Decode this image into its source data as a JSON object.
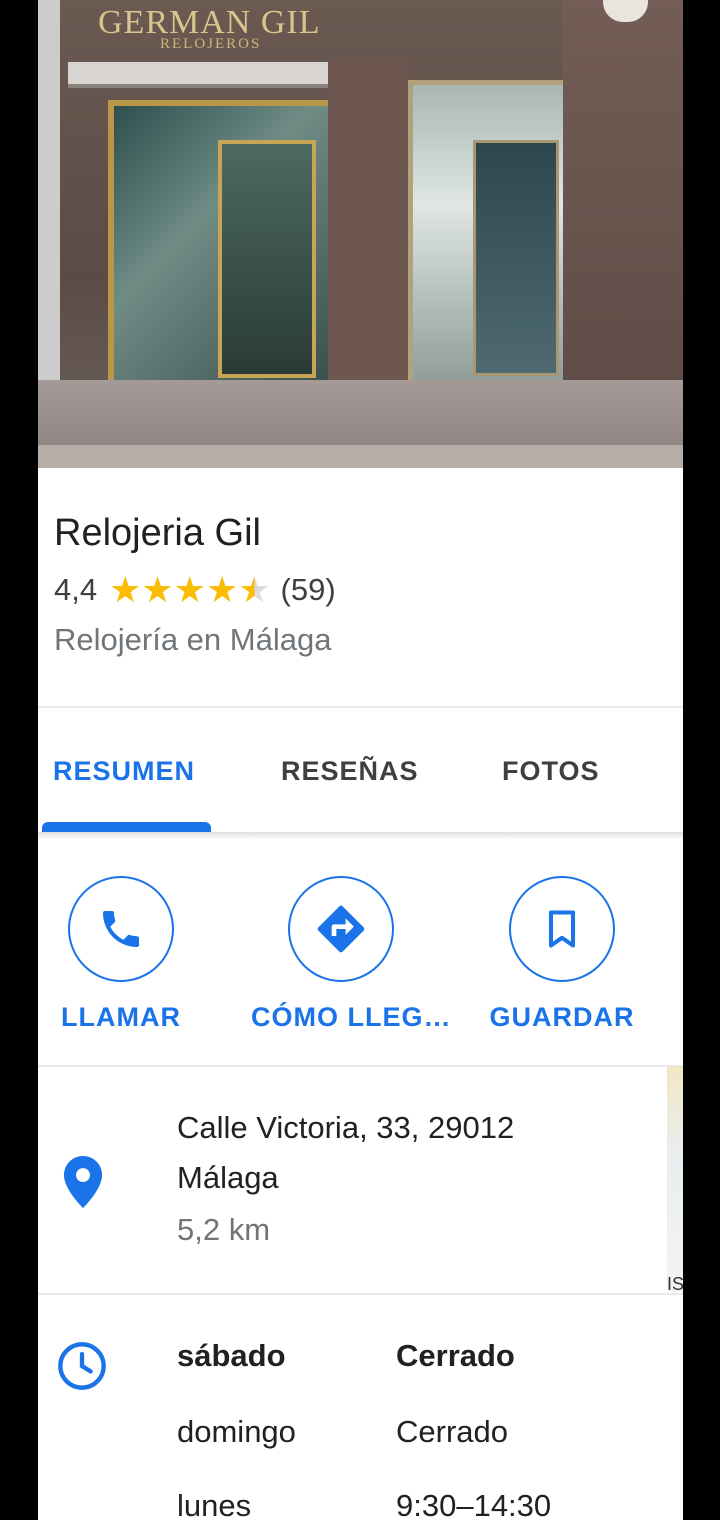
{
  "place": {
    "name": "Relojeria Gil",
    "rating": "4,4",
    "rating_value": 4.4,
    "review_count": "(59)",
    "category": "Relojería en Málaga",
    "photo_sign": "GERMAN GIL",
    "photo_sign_sub": "RELOJEROS"
  },
  "tabs": [
    {
      "label": "RESUMEN",
      "active": true
    },
    {
      "label": "RESEÑAS",
      "active": false
    },
    {
      "label": "FOTOS",
      "active": false
    }
  ],
  "actions": [
    {
      "label": "LLAMAR",
      "icon": "phone-icon"
    },
    {
      "label": "CÓMO LLEG…",
      "icon": "directions-icon"
    },
    {
      "label": "GUARDAR",
      "icon": "bookmark-icon"
    }
  ],
  "address": {
    "line1": "Calle Victoria, 33, 29012",
    "line2": "Málaga",
    "distance": "5,2 km",
    "map_fragment": "IS"
  },
  "hours": [
    {
      "day": "sábado",
      "time": "Cerrado",
      "current": true
    },
    {
      "day": "domingo",
      "time": "Cerrado",
      "current": false
    },
    {
      "day": "lunes",
      "time": "9:30–14:30",
      "current": false
    }
  ],
  "colors": {
    "accent": "#1a73e8",
    "star": "#fbbc04",
    "text_primary": "#202124",
    "text_secondary": "#70757a"
  }
}
